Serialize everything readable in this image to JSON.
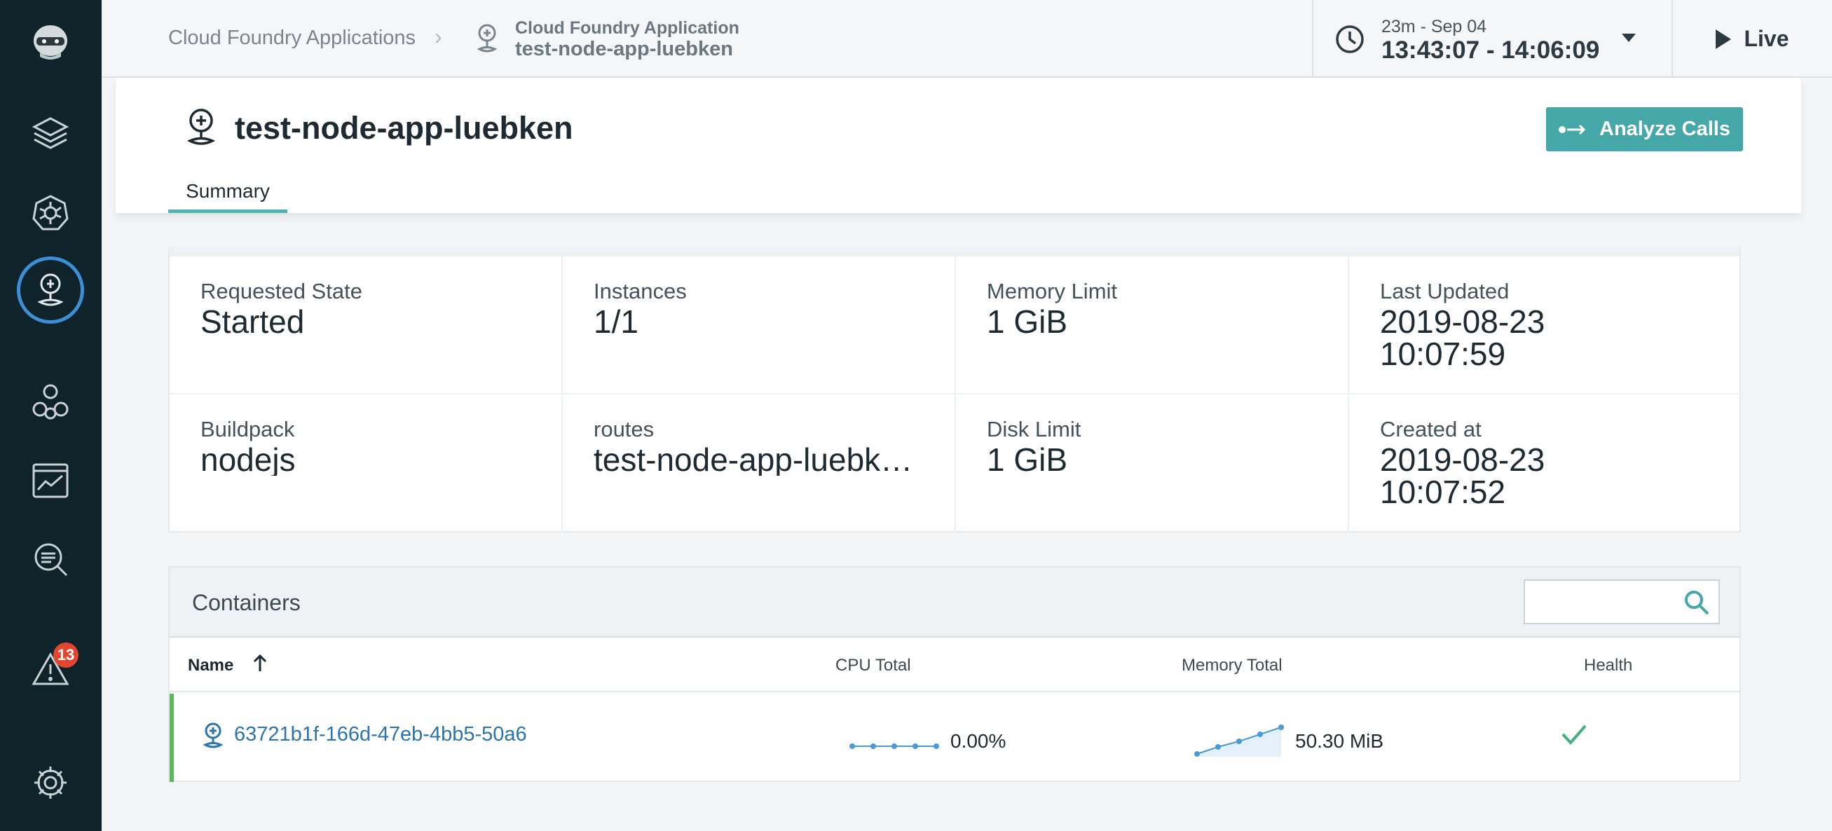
{
  "breadcrumb": {
    "parent": "Cloud Foundry Applications",
    "current_type": "Cloud Foundry Application",
    "current_name": "test-node-app-luebken"
  },
  "timepicker": {
    "range_label": "23m - Sep 04",
    "range_value": "13:43:07 - 14:06:09"
  },
  "live_label": "Live",
  "app": {
    "title": "test-node-app-luebken",
    "tab": "Summary",
    "analyze_label": "Analyze Calls"
  },
  "summary": {
    "requested_state": {
      "label": "Requested State",
      "value": "Started"
    },
    "instances": {
      "label": "Instances",
      "value": "1/1"
    },
    "memory_limit": {
      "label": "Memory Limit",
      "value": "1 GiB"
    },
    "last_updated": {
      "label": "Last Updated",
      "date": "2019-08-23",
      "time": "10:07:59"
    },
    "buildpack": {
      "label": "Buildpack",
      "value": "nodejs"
    },
    "routes": {
      "label": "routes",
      "value": "test-node-app-luebken.cfapps.io"
    },
    "disk_limit": {
      "label": "Disk Limit",
      "value": "1 GiB"
    },
    "created_at": {
      "label": "Created at",
      "date": "2019-08-23",
      "time": "10:07:52"
    }
  },
  "containers": {
    "title": "Containers",
    "search_placeholder": "",
    "columns": {
      "name": "Name",
      "cpu": "CPU Total",
      "memory": "Memory Total",
      "health": "Health"
    },
    "rows": [
      {
        "name": "63721b1f-166d-47eb-4bb5-50a6",
        "cpu": "0.00%",
        "memory": "50.30 MiB",
        "health": "healthy"
      }
    ]
  },
  "alerts_count": "13",
  "colors": {
    "accent": "#45a7a7",
    "sidebar": "#0f232b",
    "link": "#2a74b0",
    "healthy": "#5cb85c",
    "alert": "#e3462e"
  },
  "icons": [
    "robot-logo-icon",
    "stack-icon",
    "kubernetes-icon",
    "cloud-foundry-icon",
    "services-icon",
    "dashboard-icon",
    "analyze-icon",
    "alert-icon",
    "settings-icon",
    "clock-icon",
    "play-icon",
    "search-icon",
    "sort-up-icon",
    "check-icon"
  ]
}
